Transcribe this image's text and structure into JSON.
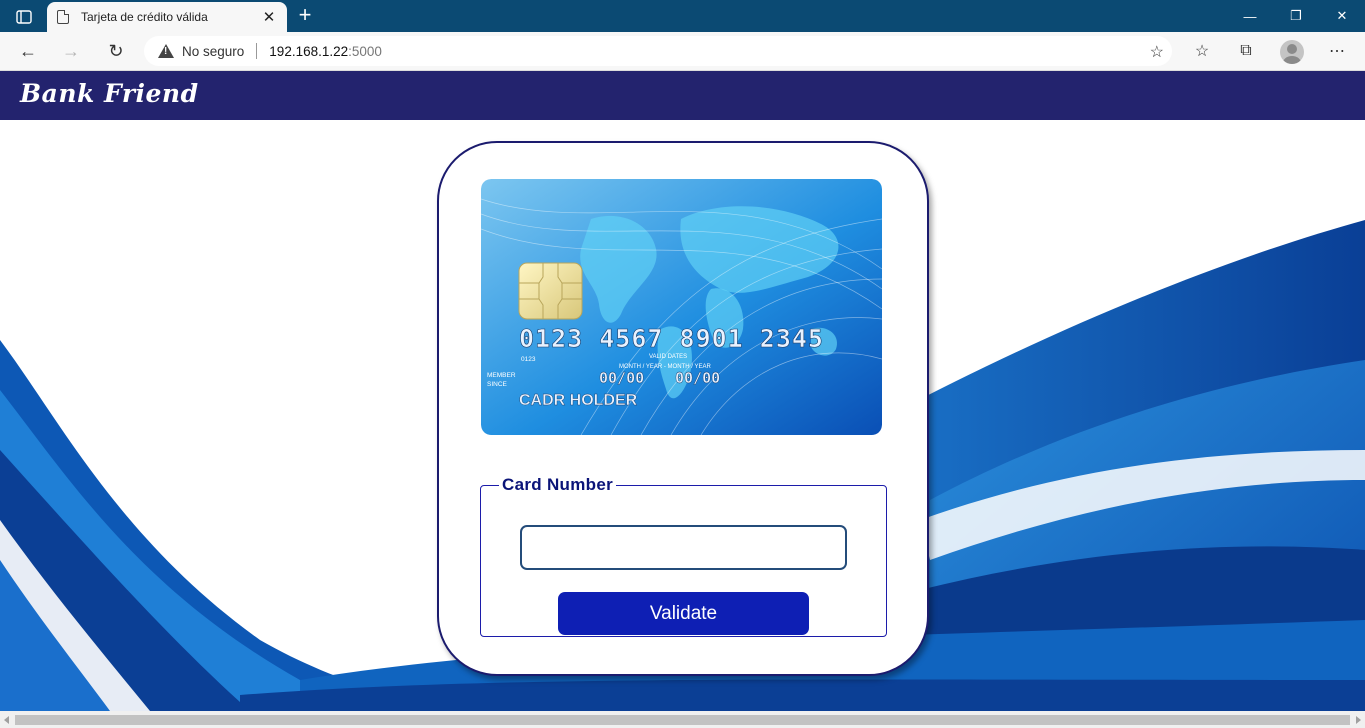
{
  "browser": {
    "tab_title": "Tarjeta de crédito válida",
    "security_label": "No seguro",
    "url_host": "192.168.1.22",
    "url_port": ":5000"
  },
  "site": {
    "brand": "Bank Friend"
  },
  "card_image": {
    "number": "0123  4567  8901  2345",
    "small_number": "0123",
    "valid_dates": "VALID DATES",
    "month_year": "MONTH / YEAR - MONTH / YEAR",
    "member_since_1": "MEMBER",
    "member_since_2": "SINCE",
    "date_1": "00/00",
    "date_2": "00/00",
    "holder": "CADR HOLDER"
  },
  "form": {
    "legend": "Card Number",
    "input_value": "",
    "validate_label": "Validate"
  },
  "colors": {
    "header_bg": "#23236e",
    "button_bg": "#0e1fb4",
    "accent_blue": "#1565c0"
  }
}
